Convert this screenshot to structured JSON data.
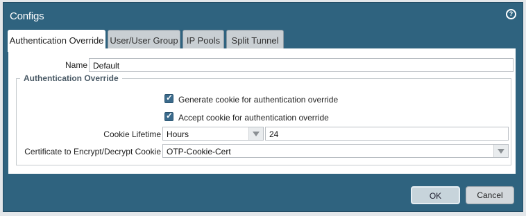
{
  "dialog": {
    "title": "Configs",
    "help_icon": "question-icon"
  },
  "tabs": [
    {
      "label": "Authentication Override",
      "active": true
    },
    {
      "label": "User/User Group",
      "active": false
    },
    {
      "label": "IP Pools",
      "active": false
    },
    {
      "label": "Split Tunnel",
      "active": false
    }
  ],
  "form": {
    "name_label": "Name",
    "name_value": "Default",
    "section_title": "Authentication Override",
    "generate_cookie_label": "Generate cookie for authentication override",
    "generate_cookie_checked": true,
    "accept_cookie_label": "Accept cookie for authentication override",
    "accept_cookie_checked": true,
    "cookie_lifetime_label": "Cookie Lifetime",
    "cookie_lifetime_unit": "Hours",
    "cookie_lifetime_value": "24",
    "certificate_label": "Certificate to Encrypt/Decrypt Cookie",
    "certificate_value": "OTP-Cookie-Cert"
  },
  "buttons": {
    "ok": "OK",
    "cancel": "Cancel"
  },
  "colors": {
    "dialog_bg": "#2f637f",
    "checkbox": "#3a6a8b"
  }
}
